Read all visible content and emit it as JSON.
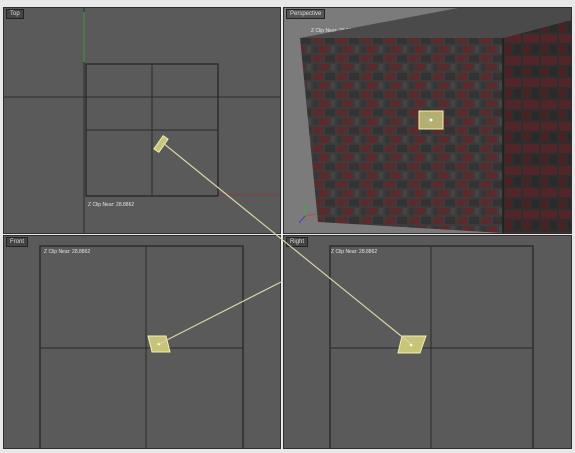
{
  "viewports": {
    "top": {
      "label": "Top",
      "clip": "Z Clip Near: 28.8862"
    },
    "perspective": {
      "label": "Perspective",
      "clip": "Z Clip Near: 28.8862"
    },
    "front": {
      "label": "Front",
      "clip": "Z Clip Near: 28.8862"
    },
    "right": {
      "label": "Right",
      "clip": "Z Clip Near: 28.8862"
    }
  },
  "colors": {
    "viewport_bg": "#5a5a5a",
    "grid_line": "#2c2c2c",
    "selection_fill": "#c8c47a",
    "selection_stroke": "#f2efb0",
    "link_line": "#d8d3a6",
    "brick_red": "#5a2a2c",
    "brick_dark": "#3a3a3a"
  },
  "icons": {
    "axis_gizmo": "axis-tripod-icon"
  }
}
